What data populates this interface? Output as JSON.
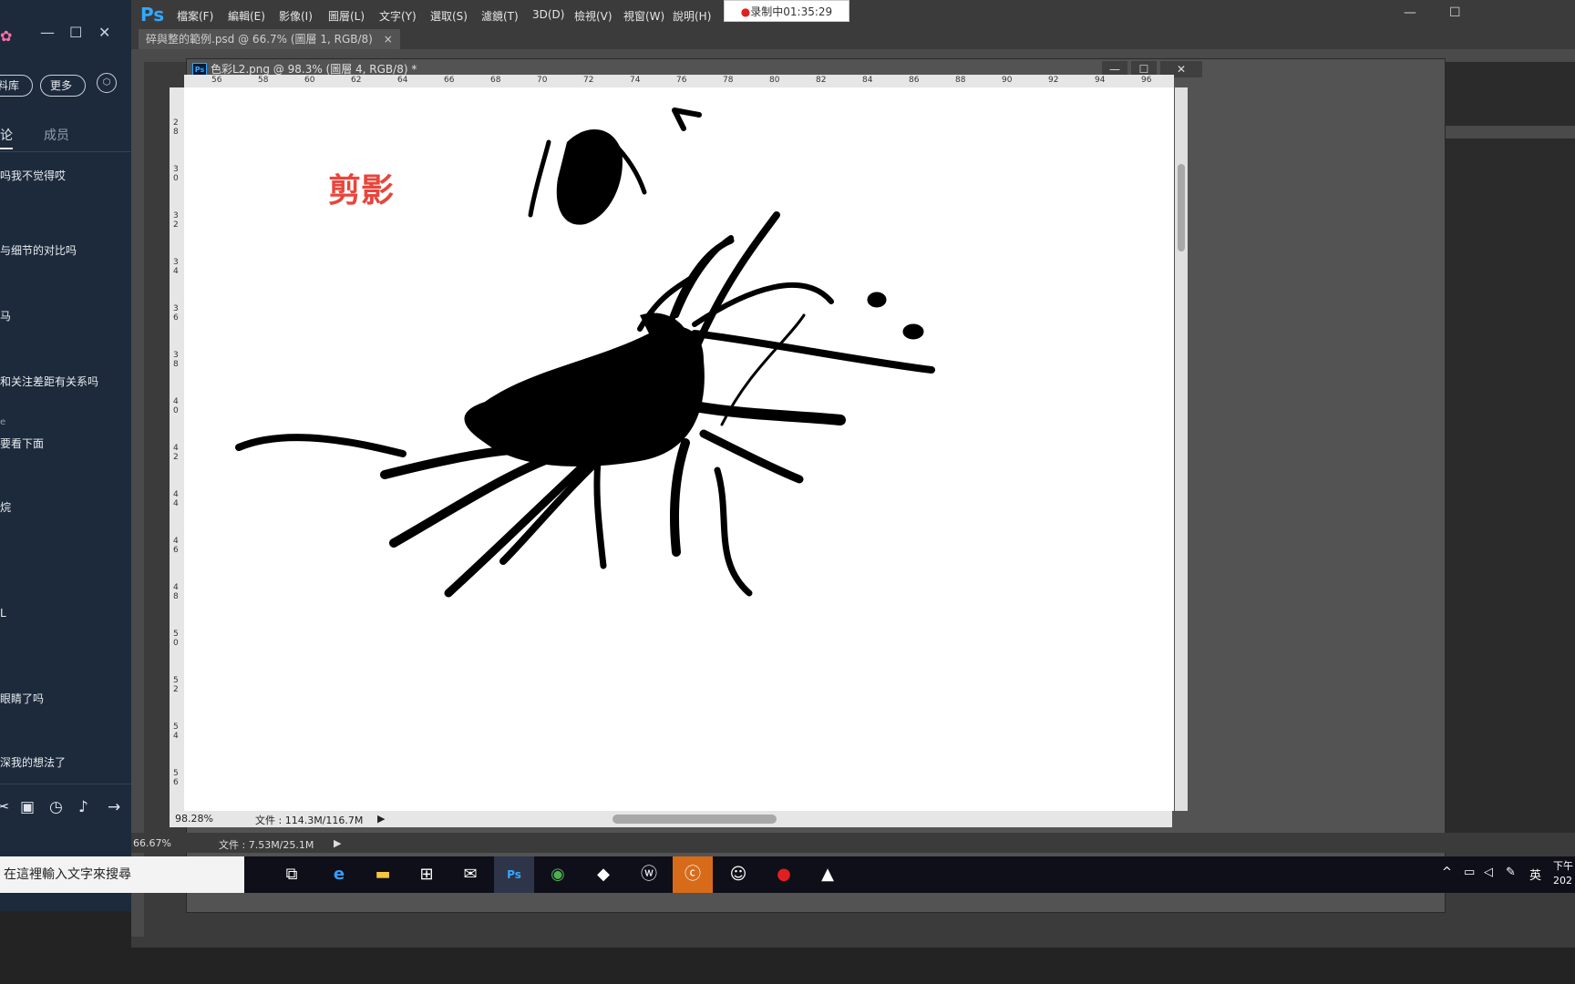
{
  "chat": {
    "buttons": [
      "料库",
      "更多"
    ],
    "tabs": [
      "论",
      "成员"
    ],
    "messages": [
      "吗我不觉得哎",
      "与细节的对比吗",
      "马",
      "和关注差距有关系吗",
      "e",
      "要看下面",
      "烷",
      "L",
      "眼睛了吗",
      "深我的想法了"
    ]
  },
  "photoshop": {
    "menu": [
      "檔案(F)",
      "編輯(E)",
      "影像(I)",
      "圖層(L)",
      "文字(Y)",
      "選取(S)",
      "濾鏡(T)",
      "3D(D)",
      "檢視(V)",
      "視窗(W)",
      "說明(H)"
    ],
    "recording_label": "录制中01:35:29",
    "tab1_title": "碎與整的範例.psd @ 66.7% (圖層 1, RGB/8)",
    "doc_title": "色彩L2.png @ 98.3% (圖層 4, RGB/8) *",
    "right_tab_fragment": "*) *",
    "ruler_top_ticks": [
      "56",
      "58",
      "60",
      "62",
      "64",
      "66",
      "68",
      "70",
      "72",
      "74",
      "76",
      "78",
      "80",
      "82",
      "84",
      "86",
      "88",
      "90",
      "92",
      "94",
      "96"
    ],
    "ruler_left_ticks": [
      "28",
      "30",
      "32",
      "34",
      "36",
      "38",
      "40",
      "42",
      "44",
      "46",
      "48",
      "50",
      "52",
      "54",
      "56"
    ],
    "doc_zoom": "98.28%",
    "doc_file_info": "文件 : 114.3M/116.7M",
    "main_zoom": "66.67%",
    "main_file_info": "文件 : 7.53M/25.1M",
    "canvas_red_text": "剪影"
  },
  "taskbar": {
    "search_placeholder": "在這裡輸入文字來搜尋",
    "tray_lang": "英",
    "tray_time": "下午",
    "tray_date": "202"
  }
}
